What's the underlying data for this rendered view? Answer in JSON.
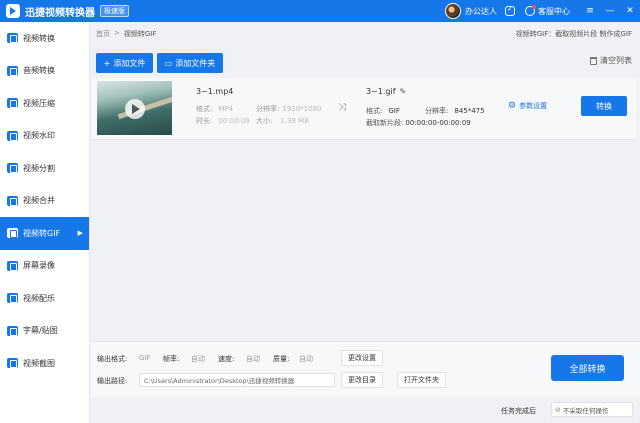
{
  "titlebar": {
    "app_title": "迅捷视频转换器",
    "edition": "极速版",
    "user_name": "办公达人",
    "support_label": "客服中心",
    "menu_glyph": "≡",
    "minimize_glyph": "—",
    "close_glyph": "✕"
  },
  "sidebar": {
    "items": [
      {
        "label": "视频转换",
        "icon": "video-convert-icon"
      },
      {
        "label": "音频转换",
        "icon": "audio-convert-icon"
      },
      {
        "label": "视频压缩",
        "icon": "video-compress-icon"
      },
      {
        "label": "视频水印",
        "icon": "video-watermark-icon"
      },
      {
        "label": "视频分割",
        "icon": "video-split-icon"
      },
      {
        "label": "视频合并",
        "icon": "video-merge-icon"
      },
      {
        "label": "视频转GIF",
        "icon": "video-gif-icon",
        "active": true
      },
      {
        "label": "屏幕录像",
        "icon": "screen-record-icon"
      },
      {
        "label": "视频配乐",
        "icon": "video-music-icon"
      },
      {
        "label": "字幕/贴图",
        "icon": "subtitle-icon"
      },
      {
        "label": "视频截图",
        "icon": "video-screenshot-icon"
      }
    ]
  },
  "breadcrumb": {
    "home": "首页",
    "sep": ">",
    "current": "视频转GIF"
  },
  "feature_desc": "视频转GIF：截取视频片段 制作成GIF",
  "toolbar": {
    "add_file": "添加文件",
    "add_folder": "添加文件夹",
    "clear_list": "清空列表"
  },
  "file": {
    "src_name": "3~1.mp4",
    "format_label": "格式:",
    "format": "MP4",
    "resolution_label": "分辨率:",
    "resolution": "1920*1080",
    "duration_label": "时长:",
    "duration": "00:00:09",
    "size_label": "大小:",
    "size": "1.38 MB",
    "out_name": "3~1.gif",
    "out_format_label": "格式:",
    "out_format": "GIF",
    "out_resolution_label": "分辨率:",
    "out_resolution": "845*475",
    "clip_label": "截取新片段:",
    "clip_range": "00:00:00-00:00:09",
    "params_label": "参数设置",
    "convert_label": "转换"
  },
  "bottom": {
    "output_format_label": "输出格式:",
    "output_format": "GIF",
    "fps_label": "帧率:",
    "fps": "自动",
    "speed_label": "速度:",
    "speed": "自动",
    "quality_label": "质量:",
    "quality": "自动",
    "change_settings": "更改设置",
    "output_path_label": "输出路径:",
    "output_path": "C:\\Users\\Administrator\\Desktop\\迅捷视频转换器",
    "change_dir": "更改目录",
    "open_folder": "打开文件夹",
    "convert_all": "全部转换"
  },
  "status": {
    "after_done_label": "任务完成后",
    "after_done_value": "不采取任何操作"
  },
  "colors": {
    "accent": "#1677e8"
  }
}
